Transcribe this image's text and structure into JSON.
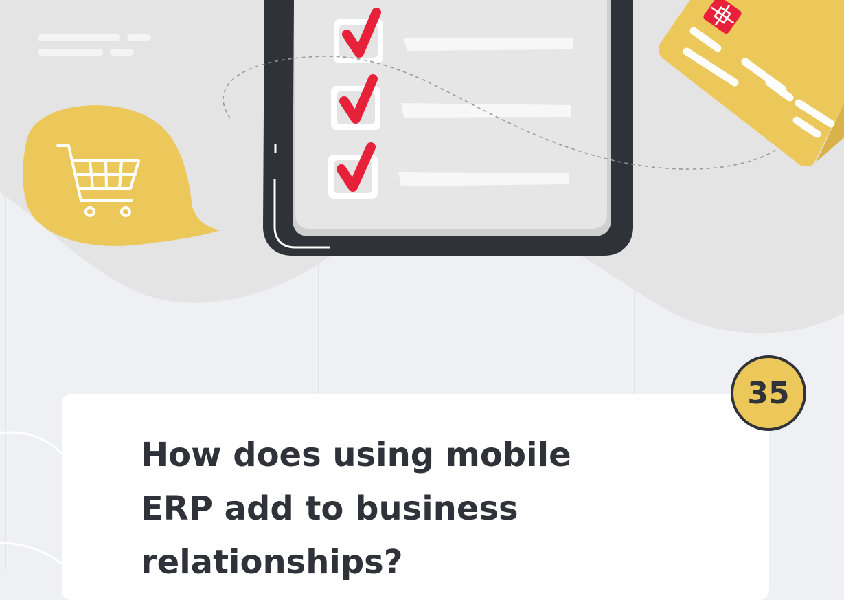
{
  "question": {
    "line1": "How does using mobile",
    "line2": "ERP add to business",
    "line3": "relationships?"
  },
  "badge_number": "35",
  "colors": {
    "background": "#eff0f3",
    "blob": "#e4e4e4",
    "accent_yellow": "#ecc759",
    "dark": "#2f3238",
    "check_red": "#e8213a",
    "card": "#ffffff"
  },
  "icons": [
    "shopping-cart-icon",
    "credit-card-icon",
    "checkmark-icon",
    "speech-bubble-icon",
    "tablet-icon"
  ]
}
